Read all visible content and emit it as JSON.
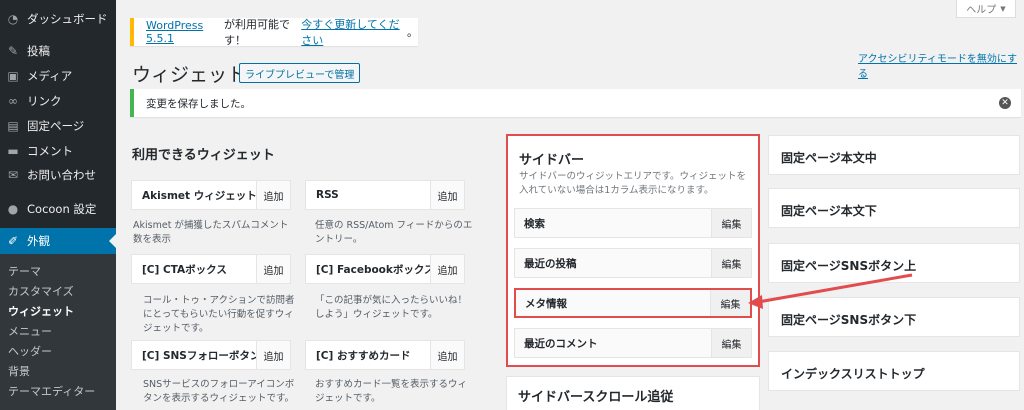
{
  "admin_menu": {
    "items": [
      {
        "icon": "dashboard-icon",
        "glyph": "◔",
        "label": "ダッシュボード"
      },
      {
        "icon": "pin-icon",
        "glyph": "✎",
        "label": "投稿"
      },
      {
        "icon": "media-icon",
        "glyph": "▣",
        "label": "メディア"
      },
      {
        "icon": "link-icon",
        "glyph": "∞",
        "label": "リンク"
      },
      {
        "icon": "page-icon",
        "glyph": "▤",
        "label": "固定ページ"
      },
      {
        "icon": "comment-icon",
        "glyph": "▬",
        "label": "コメント"
      },
      {
        "icon": "mail-icon",
        "glyph": "✉",
        "label": "お問い合わせ"
      },
      {
        "icon": "cocoon-icon",
        "glyph": "●",
        "label": "Cocoon 設定"
      },
      {
        "icon": "appearance-icon",
        "glyph": "✐",
        "label": "外観"
      }
    ],
    "submenu": [
      "テーマ",
      "カスタマイズ",
      "ウィジェット",
      "メニュー",
      "ヘッダー",
      "背景",
      "テーマエディター"
    ]
  },
  "help_tab": {
    "label": "ヘルプ",
    "arrow": "▼"
  },
  "update_nag": {
    "version": "WordPress 5.5.1",
    "text": " が利用可能です！",
    "link": "今すぐ更新してください",
    "end": "。"
  },
  "a11y_link": "アクセシビリティモードを無効にする",
  "page_title": "ウィジェット",
  "live_preview": "ライブプレビューで管理",
  "saved_notice": "変更を保存しました。",
  "available": {
    "title": "利用できるウィジェット",
    "add_label": "追加",
    "widgets": [
      {
        "title": "Akismet ウィジェット",
        "desc": "Akismet が捕獲したスパムコメント数を表示"
      },
      {
        "title": "RSS",
        "desc": "任意の RSS/Atom フィードからのエントリー。"
      },
      {
        "title": "[C] CTAボックス",
        "desc": "コール・トゥ・アクションで訪問者にとってもらいたい行動を促すウィジェットです。"
      },
      {
        "title": "[C] Facebookボックス",
        "desc": "「この記事が気に入ったらいいね！しよう」ウィジェットです。"
      },
      {
        "title": "[C] SNSフォローボタン",
        "desc": "SNSサービスのフォローアイコンボタンを表示するウィジェットです。"
      },
      {
        "title": "[C] おすすめカード",
        "desc": "おすすめカード一覧を表示するウィジェットです。"
      }
    ]
  },
  "sidebar": {
    "title": "サイドバー",
    "desc": "サイドバーのウィジットエリアです。ウィジェットを入れていない場合は1カラム表示になります。",
    "edit_label": "編集",
    "widgets": [
      "検索",
      "最近の投稿",
      "メタ情報",
      "最近のコメント"
    ]
  },
  "sidebar_scroll": "サイドバースクロール追従",
  "right_areas": [
    "固定ページ本文中",
    "固定ページ本文下",
    "固定ページSNSボタン上",
    "固定ページSNSボタン下",
    "インデックスリストトップ"
  ],
  "colors": {
    "accent": "#0073aa",
    "highlight": "#e14d4d",
    "success": "#46b450",
    "warning": "#ffb900"
  }
}
